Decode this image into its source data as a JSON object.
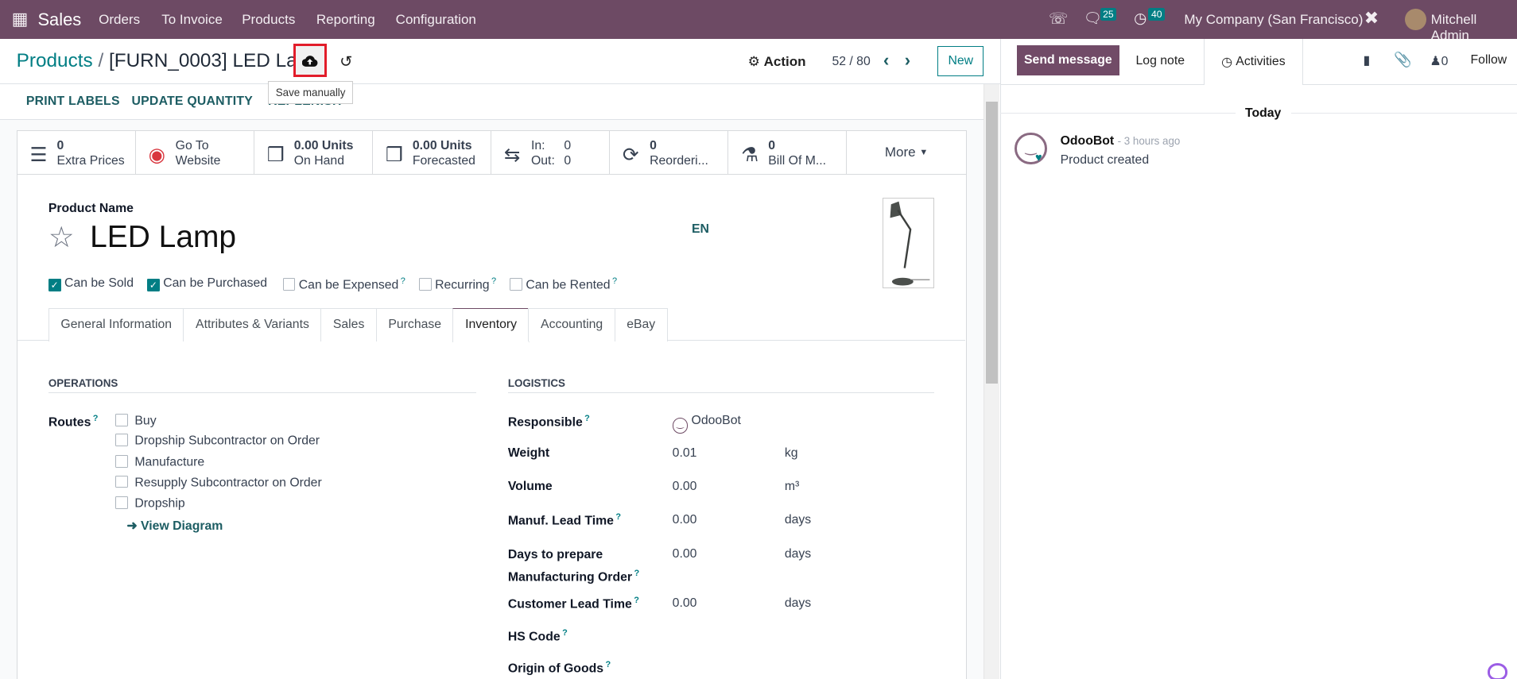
{
  "navbar": {
    "app": "Sales",
    "menu": [
      "Orders",
      "To Invoice",
      "Products",
      "Reporting",
      "Configuration"
    ],
    "messages_count": "25",
    "activities_count": "40",
    "company": "My Company (San Francisco)",
    "user": "Mitchell Admin",
    "brand_color": "#6d4a64"
  },
  "breadcrumb": {
    "parent": "Products",
    "current": "[FURN_0003] LED Lamp"
  },
  "control": {
    "save_tooltip": "Save manually",
    "action": "Action",
    "pager": "52 / 80",
    "new": "New"
  },
  "statusbar": [
    "PRINT LABELS",
    "UPDATE QUANTITY",
    "REPLENISH"
  ],
  "smart_buttons": [
    {
      "top": "0",
      "bottom": "Extra Prices",
      "icon": "list-icon"
    },
    {
      "top": "Go To",
      "bottom": "Website",
      "icon": "globe-icon"
    },
    {
      "top": "0.00 Units",
      "bottom": "On Hand",
      "icon": "cubes-icon"
    },
    {
      "top": "0.00 Units",
      "bottom": "Forecasted",
      "icon": "cubes-icon"
    },
    {
      "in_label": "In:",
      "in_value": "0",
      "out_label": "Out:",
      "out_value": "0",
      "icon": "exchange-icon"
    },
    {
      "top": "0",
      "bottom": "Reorderi...",
      "icon": "refresh-icon"
    },
    {
      "top": "0",
      "bottom": "Bill Of M...",
      "icon": "flask-icon"
    },
    {
      "label": "More"
    }
  ],
  "product": {
    "name_label": "Product Name",
    "name": "LED Lamp",
    "lang": "EN",
    "flags": [
      {
        "label": "Can be Sold",
        "checked": true
      },
      {
        "label": "Can be Purchased",
        "checked": true
      },
      {
        "label": "Can be Expensed",
        "checked": false,
        "help": "?"
      },
      {
        "label": "Recurring",
        "checked": false,
        "help": "?"
      },
      {
        "label": "Can be Rented",
        "checked": false,
        "help": "?"
      }
    ]
  },
  "tabs": [
    "General Information",
    "Attributes & Variants",
    "Sales",
    "Purchase",
    "Inventory",
    "Accounting",
    "eBay"
  ],
  "active_tab": "Inventory",
  "operations": {
    "title": "OPERATIONS",
    "routes_label": "Routes",
    "routes": [
      "Buy",
      "Dropship Subcontractor on Order",
      "Manufacture",
      "Resupply Subcontractor on Order",
      "Dropship"
    ],
    "view_diagram": "View Diagram"
  },
  "logistics": {
    "title": "LOGISTICS",
    "responsible_label": "Responsible",
    "responsible": "OdooBot",
    "weight_label": "Weight",
    "weight": "0.01",
    "weight_unit": "kg",
    "volume_label": "Volume",
    "volume": "0.00",
    "volume_unit": "m³",
    "manuf_label": "Manuf. Lead Time",
    "manuf": "0.00",
    "manuf_unit": "days",
    "days_label_1": "Days to prepare",
    "days_label_2": "Manufacturing Order",
    "days": "0.00",
    "days_unit": "days",
    "customer_label": "Customer Lead Time",
    "customer": "0.00",
    "customer_unit": "days",
    "hs_label": "HS Code",
    "origin_label": "Origin of Goods"
  },
  "chatter": {
    "send": "Send message",
    "log": "Log note",
    "activities": "Activities",
    "followers": "0",
    "follow": "Follow",
    "today": "Today",
    "author": "OdooBot",
    "time": "- 3 hours ago",
    "message": "Product created"
  }
}
